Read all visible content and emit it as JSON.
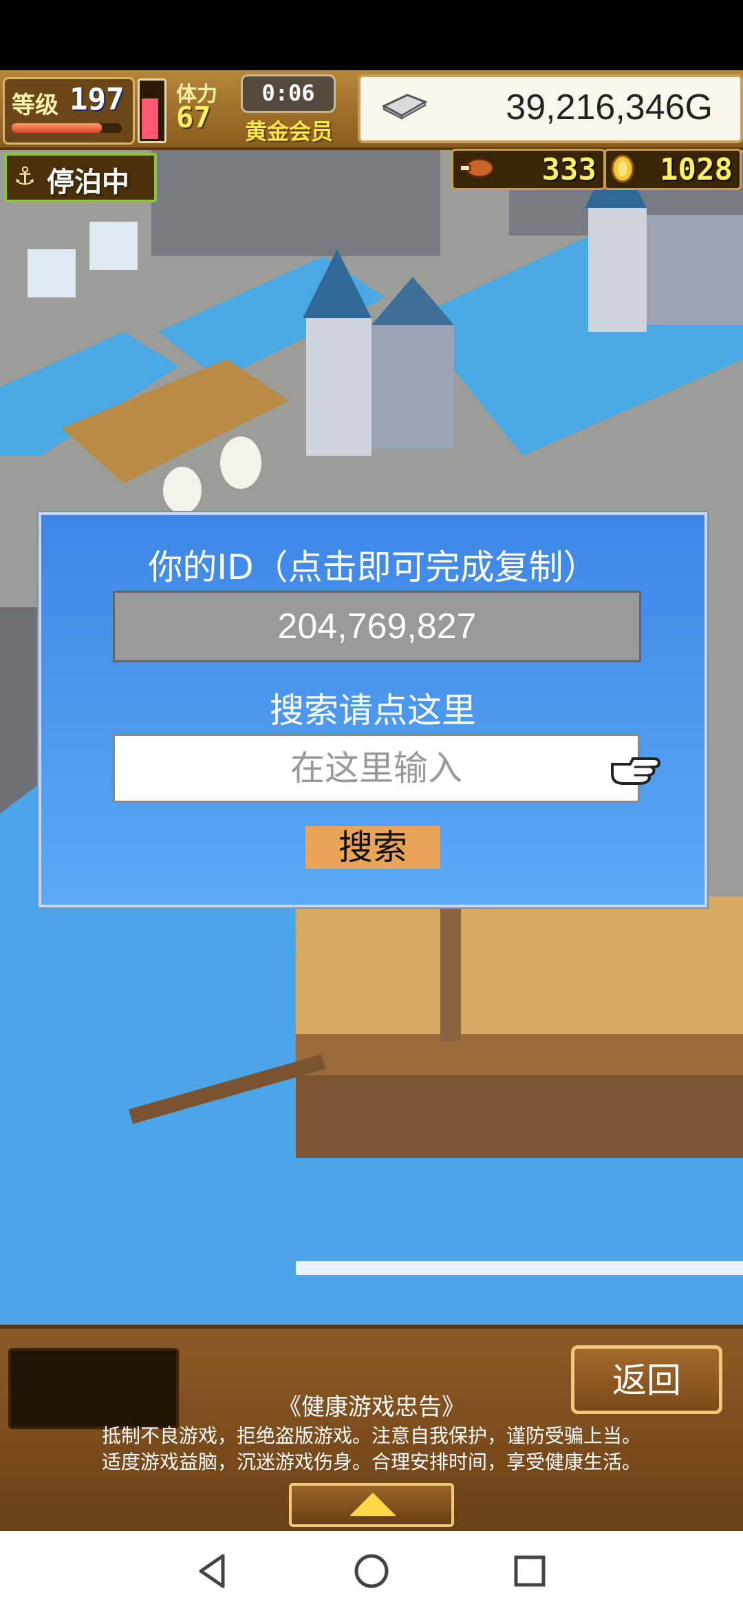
{
  "hud": {
    "level_label": "等级",
    "level_value": "197",
    "stamina_label": "体力",
    "stamina_value": "67",
    "stamina_fraction": 0.72,
    "timer": "0:06",
    "member_label": "黄金会员",
    "gold": "39,216,346G",
    "docked_label": "停泊中",
    "food_count": "333",
    "medal_count": "1028"
  },
  "dialog": {
    "title": "你的ID（点击即可完成复制）",
    "user_id": "204,769,827",
    "search_label": "搜索请点这里",
    "search_placeholder": "在这里输入",
    "search_value": "",
    "search_button": "搜索"
  },
  "bottom": {
    "back_button": "返回",
    "notice_title": "《健康游戏忠告》",
    "notice_line1": "抵制不良游戏，拒绝盗版游戏。注意自我保护，谨防受骗上当。",
    "notice_line2": "适度游戏益脑，沉迷游戏伤身。合理安排时间，享受健康生活。"
  },
  "nav": {
    "icons": [
      "back-triangle-icon",
      "home-circle-icon",
      "recents-square-icon"
    ]
  },
  "colors": {
    "dialog_bg": "#4a95ec",
    "search_button_bg": "#e9a456",
    "water": "#4aa6e8",
    "deck": "#d9a864"
  }
}
